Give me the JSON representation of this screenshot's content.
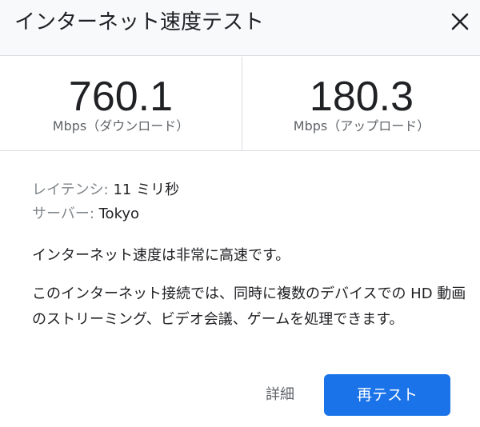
{
  "dialog": {
    "title": "インターネット速度テスト"
  },
  "download": {
    "value": "760.1",
    "unit": "Mbps（ダウンロード）"
  },
  "upload": {
    "value": "180.3",
    "unit": "Mbps（アップロード）"
  },
  "info": {
    "latency_label": "レイテンシ:",
    "latency_value": "11 ミリ秒",
    "server_label": "サーバー:",
    "server_value": "Tokyo"
  },
  "summary": "インターネット速度は非常に高速です。",
  "detail": "このインターネット接続では、同時に複数のデバイスでの HD 動画のストリーミング、ビデオ会議、ゲームを処理できます。",
  "buttons": {
    "details": "詳細",
    "retest": "再テスト"
  },
  "colors": {
    "accent": "#1a73e8",
    "header_bg": "#f8f9fa",
    "divider": "#dadce0"
  },
  "icons": {
    "close": "close-icon"
  }
}
